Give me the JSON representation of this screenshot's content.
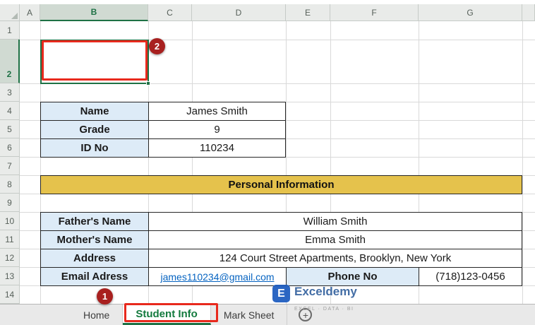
{
  "colors": {
    "accent_green": "#1E7145",
    "tab_active_green": "#137A3D",
    "label_fill_blue": "#DDEBF7",
    "section_fill_gold": "#E5C24C",
    "annotation_red": "#E8291D",
    "badge_red": "#A8201F",
    "hyperlink_blue": "#0563C1",
    "watermark_blue": "#35639F"
  },
  "grid": {
    "col_headers": [
      "A",
      "B",
      "C",
      "D",
      "E",
      "F",
      "G",
      ""
    ],
    "row_headers": [
      "1",
      "2",
      "3",
      "4",
      "5",
      "6",
      "7",
      "8",
      "9",
      "10",
      "11",
      "12",
      "13",
      "14"
    ],
    "selected_column": "B",
    "selected_row": "2"
  },
  "info_table": {
    "rows": [
      {
        "label": "Name",
        "value": "James Smith"
      },
      {
        "label": "Grade",
        "value": "9"
      },
      {
        "label": "ID No",
        "value": "110234"
      }
    ]
  },
  "section_header": "Personal Information",
  "personal_table": {
    "rows": [
      {
        "label": "Father's Name",
        "value": "William Smith"
      },
      {
        "label": "Mother's Name",
        "value": "Emma Smith"
      },
      {
        "label": "Address",
        "value": "124 Court Street Apartments, Brooklyn, New York"
      }
    ],
    "email_label": "Email Adress",
    "email_value": "james110234@gmail.com",
    "phone_label": "Phone No",
    "phone_value": "(718)123-0456"
  },
  "sheet_tabs": {
    "tabs": [
      {
        "label": "Home"
      },
      {
        "label": "Student Info"
      },
      {
        "label": "Mark Sheet"
      }
    ],
    "active_tab": "Student Info",
    "add_label": "+"
  },
  "annotations": {
    "badge_cell": "2",
    "badge_tab": "1"
  },
  "watermark": {
    "logo_letter": "E",
    "name": "Exceldemy",
    "tagline": "EXCEL · DATA · BI"
  }
}
